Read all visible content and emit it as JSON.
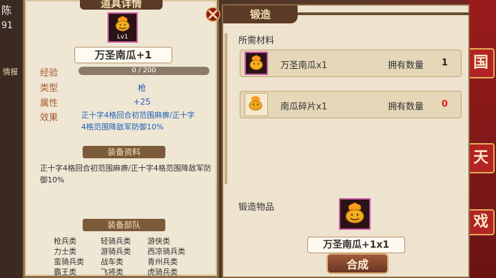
{
  "corner": {
    "name_partial": "陈",
    "number_partial": "91",
    "menu_partial": "情报"
  },
  "right_tiles": [
    "国",
    "天",
    "戏"
  ],
  "item_panel": {
    "title": "道具详情",
    "item_level": "Lv1",
    "item_name": "万圣南瓜+1",
    "exp_label": "经验",
    "exp_value": "0  / 200",
    "exp_progress": 0,
    "type_label": "类型",
    "type_value": "枪",
    "attr_label": "属性",
    "attr_value": "+25",
    "effect_label": "效果",
    "effect_value": "正十字4格回合初范围麻痹/正十字4格范围降敌军防御10%",
    "info_header": "装备资料",
    "info_text": "正十字4格回合初范围麻痹/正十字4格范围降敌军防御10%",
    "troops_header": "装备部队",
    "troops": [
      "枪兵类",
      "轻骑兵类",
      "游侠类",
      "力士类",
      "游骑兵类",
      "西凉骑兵类",
      "蛮骑兵类",
      "战车类",
      "青州兵类",
      "霸王类",
      "飞将类",
      "虎骑兵类"
    ]
  },
  "forge_panel": {
    "title": "锻造",
    "materials_label": "所需材料",
    "materials": [
      {
        "name": "万圣南瓜x1",
        "own_label": "拥有数量",
        "count": "1",
        "count_color": "#222222"
      },
      {
        "name": "南瓜碎片x1",
        "own_label": "拥有数量",
        "count": "0",
        "count_color": "#e02020"
      }
    ],
    "output_label": "锻造物品",
    "output_name": "万圣南瓜+1x1",
    "forge_button": "合成"
  }
}
